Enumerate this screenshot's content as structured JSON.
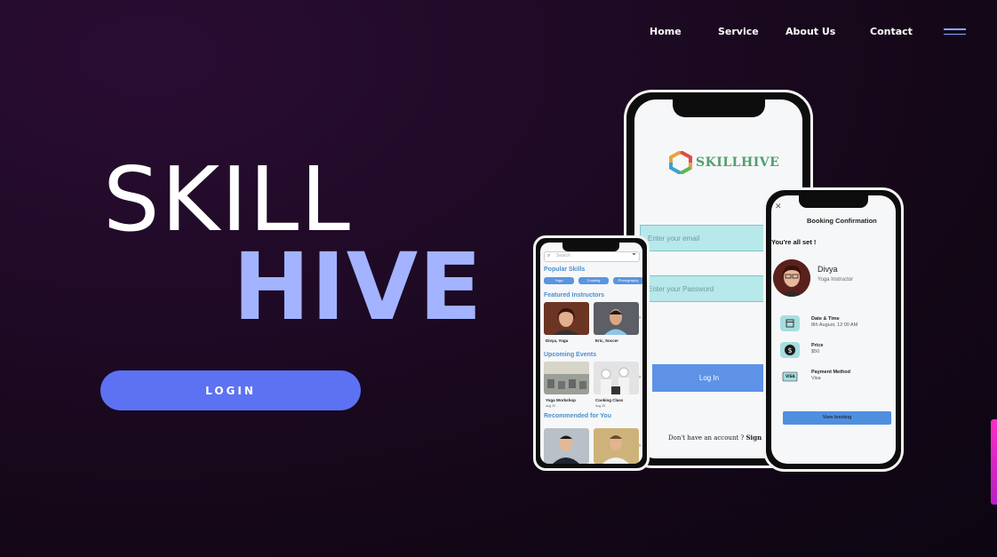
{
  "nav": {
    "items": [
      "Home",
      "Service",
      "About Us",
      "Contact"
    ],
    "menu_icon": "hamburger-icon"
  },
  "hero": {
    "title_line1": "SKILL",
    "title_line2": "HIVE",
    "login_label": "LOGIN"
  },
  "login_screen": {
    "brand": "SKILLHIVE",
    "email_placeholder": "Enter your email",
    "password_placeholder": "Enter your Password",
    "login_button": "Log In",
    "signup_prompt": "Don't have an account ? ",
    "signup_link": "Sign Up"
  },
  "home_screen": {
    "search_placeholder": "Search",
    "popular_skills_title": "Popular Skills",
    "skills": [
      "Yoga",
      "Cooking",
      "Photography"
    ],
    "featured_title": "Featured Instructors",
    "instructors": [
      "Divya, Yoga",
      "Eric, Soccer"
    ],
    "events_title": "Upcoming Events",
    "events": [
      {
        "name": "Yoga Workshop",
        "date": "Aug 20"
      },
      {
        "name": "Cooking Class",
        "date": "Aug 25"
      }
    ],
    "recommended_title": "Recommended for You"
  },
  "booking_screen": {
    "title": "Booking Confirmation",
    "confirmation": "You're all set !",
    "instructor_name": "Divya",
    "instructor_role": "Yoga Instructor",
    "date_label": "Date & Time",
    "date_value": "8th August, 12:00 AM",
    "price_label": "Price",
    "price_value": "$50",
    "payment_label": "Payment Method",
    "payment_value": "Visa",
    "visa_icon_text": "VISA",
    "view_button": "View booking"
  },
  "colors": {
    "accent": "#5c72f2",
    "hive_text": "#a3b3ff",
    "background": "#1f0a26"
  }
}
